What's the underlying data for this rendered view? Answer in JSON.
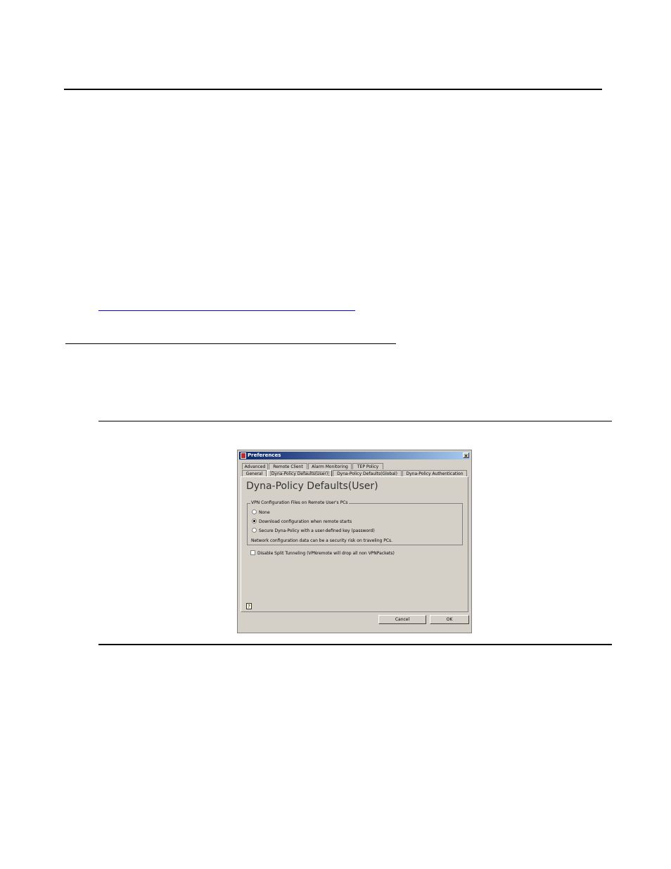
{
  "dialog": {
    "title": "Preferences",
    "close_glyph": "×",
    "tabs_row1": [
      "Advanced",
      "Remote Client",
      "Alarm Monitoring",
      "TEP Policy"
    ],
    "tabs_row2": [
      "General",
      "Dyna-Policy Defaults(User)",
      "Dyna-Policy Defaults(Global)",
      "Dyna-Policy Authentication"
    ],
    "active_tab": "Dyna-Policy Defaults(User)",
    "panel_title": "Dyna-Policy Defaults(User)",
    "group_title": "VPN Configuration Files on Remote User's PCs",
    "options": [
      {
        "label": "None",
        "checked": false
      },
      {
        "label": "Download configuration when remote starts",
        "checked": true
      },
      {
        "label": "Secure Dyna-Policy with a user-defined key (password)",
        "checked": false
      }
    ],
    "note": "Network configuration data can be a security risk on traveling PCs.",
    "checkbox_label": "Disable Split Tunneling (VPNremote will drop all non VPNPackets)",
    "checkbox_checked": false,
    "help_icon": "?",
    "cancel_label": "Cancel",
    "ok_label": "OK",
    "colors": {
      "titlebar_start": "#0a246a",
      "titlebar_end": "#a6caf0",
      "face": "#d4d0c8"
    }
  }
}
